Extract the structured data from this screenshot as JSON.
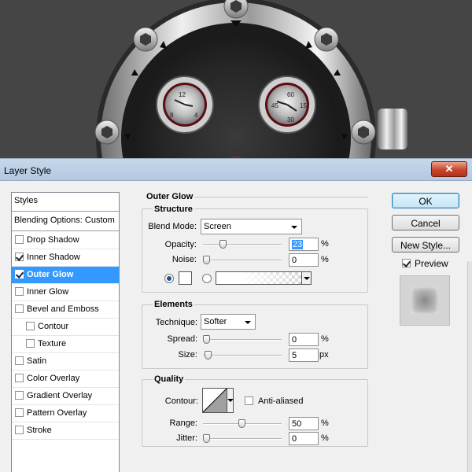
{
  "window": {
    "title": "Layer Style",
    "close_glyph": "✕"
  },
  "artwork": {
    "left_dial": [
      "12",
      "8",
      "4"
    ],
    "right_dial": [
      "60",
      "45",
      "15",
      "30"
    ]
  },
  "styles_panel": {
    "header": "Styles",
    "blending": "Blending Options: Custom",
    "items": [
      {
        "label": "Drop Shadow",
        "checked": false,
        "selected": false,
        "indent": false
      },
      {
        "label": "Inner Shadow",
        "checked": true,
        "selected": false,
        "indent": false
      },
      {
        "label": "Outer Glow",
        "checked": true,
        "selected": true,
        "indent": false
      },
      {
        "label": "Inner Glow",
        "checked": false,
        "selected": false,
        "indent": false
      },
      {
        "label": "Bevel and Emboss",
        "checked": false,
        "selected": false,
        "indent": false
      },
      {
        "label": "Contour",
        "checked": false,
        "selected": false,
        "indent": true
      },
      {
        "label": "Texture",
        "checked": false,
        "selected": false,
        "indent": true
      },
      {
        "label": "Satin",
        "checked": false,
        "selected": false,
        "indent": false
      },
      {
        "label": "Color Overlay",
        "checked": false,
        "selected": false,
        "indent": false
      },
      {
        "label": "Gradient Overlay",
        "checked": false,
        "selected": false,
        "indent": false
      },
      {
        "label": "Pattern Overlay",
        "checked": false,
        "selected": false,
        "indent": false
      },
      {
        "label": "Stroke",
        "checked": false,
        "selected": false,
        "indent": false
      }
    ]
  },
  "outer_glow": {
    "title": "Outer Glow",
    "structure": {
      "title": "Structure",
      "blend_mode_label": "Blend Mode:",
      "blend_mode_value": "Screen",
      "opacity_label": "Opacity:",
      "opacity_value": "23",
      "opacity_unit": "%",
      "opacity_level": 23,
      "noise_label": "Noise:",
      "noise_value": "0",
      "noise_unit": "%",
      "noise_level": 0
    },
    "elements": {
      "title": "Elements",
      "technique_label": "Technique:",
      "technique_value": "Softer",
      "spread_label": "Spread:",
      "spread_value": "0",
      "spread_unit": "%",
      "spread_level": 0,
      "size_label": "Size:",
      "size_value": "5",
      "size_unit": "px",
      "size_level": 2
    },
    "quality": {
      "title": "Quality",
      "contour_label": "Contour:",
      "anti_aliased_label": "Anti-aliased",
      "anti_aliased": false,
      "range_label": "Range:",
      "range_value": "50",
      "range_unit": "%",
      "range_level": 50,
      "jitter_label": "Jitter:",
      "jitter_value": "0",
      "jitter_unit": "%",
      "jitter_level": 0
    }
  },
  "buttons": {
    "ok": "OK",
    "cancel": "Cancel",
    "new_style": "New Style...",
    "preview": "Preview",
    "preview_checked": true
  },
  "colors": {
    "selection": "#3399ff",
    "dialog_bg": "#f0f0f0",
    "title_bar": "#b9cde5",
    "close_button": "#c9452d"
  },
  "icons": {
    "close": "close-icon",
    "dropdown": "chevron-down-icon"
  }
}
